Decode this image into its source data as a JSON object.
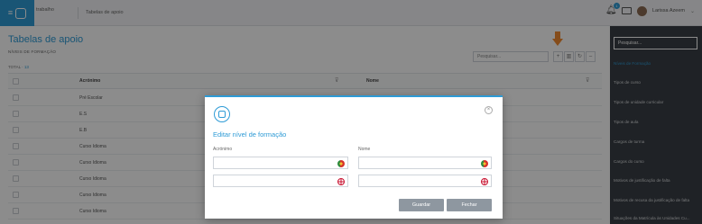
{
  "topbar": {
    "crumb1": "trabalho",
    "crumb2": "Tabelas de apoio",
    "notifications_count": "1",
    "user_name": "Larissa Azeem"
  },
  "page": {
    "title": "Tabelas de apoio",
    "subtitle": "NÍVEIS DE FORMAÇÃO",
    "total_label": "TOTAL",
    "total_count": "13",
    "search_placeholder": "Pesquisar..."
  },
  "table": {
    "columns": [
      "Acrónimo",
      "Nome"
    ],
    "rows": [
      {
        "acronimo": "Pré Escolar"
      },
      {
        "acronimo": "E.S"
      },
      {
        "acronimo": "E.B"
      },
      {
        "acronimo": "Curso Idioma"
      },
      {
        "acronimo": "Curso Idioma"
      },
      {
        "acronimo": "Curso Idioma"
      },
      {
        "acronimo": "Curso Idioma"
      },
      {
        "acronimo": "Curso Idioma"
      }
    ]
  },
  "sidebar": {
    "search_placeholder": "Pesquisar...",
    "items": [
      "Níveis de Formação",
      "Tipos de curso",
      "Tipos de unidade curricular",
      "Tipos de aula",
      "Cargos de turma",
      "Cargos do curso",
      "Motivos de justificação de falta",
      "Motivos de recusa da justificação de falta",
      "Situações da Matrícula às Unidades Cu..."
    ],
    "active_index": 0
  },
  "modal": {
    "title": "Editar nível de formação",
    "label_acronimo": "Acrónimo",
    "label_nome": "Nome",
    "save_label": "Guardar",
    "close_label": "Fechar"
  },
  "colors": {
    "accent": "#2e9bd6",
    "arrow": "#f28b30",
    "sidebar_bg": "#3a3f45",
    "button_gray": "#8e97a0"
  }
}
